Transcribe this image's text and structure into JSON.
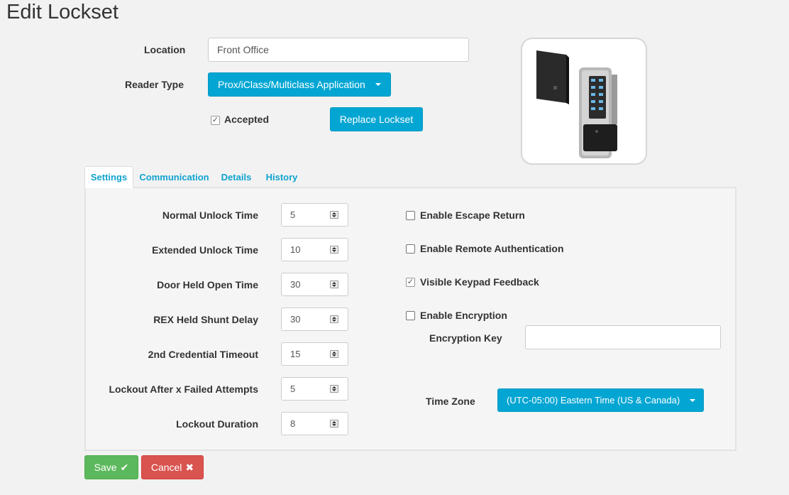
{
  "page": {
    "title": "Edit Lockset"
  },
  "form": {
    "location_label": "Location",
    "location_value": "Front Office",
    "reader_type_label": "Reader Type",
    "reader_type_value": "Prox/iClass/Multiclass Application",
    "accepted_label": "Accepted",
    "accepted_checked": true,
    "replace_button": "Replace Lockset"
  },
  "tabs": [
    {
      "label": "Settings",
      "active": true
    },
    {
      "label": "Communication",
      "active": false
    },
    {
      "label": "Details",
      "active": false
    },
    {
      "label": "History",
      "active": false
    }
  ],
  "settings": {
    "fields": [
      {
        "label": "Normal Unlock Time",
        "value": "5"
      },
      {
        "label": "Extended Unlock Time",
        "value": "10"
      },
      {
        "label": "Door Held Open Time",
        "value": "30"
      },
      {
        "label": "REX Held Shunt Delay",
        "value": "30"
      },
      {
        "label": "2nd Credential Timeout",
        "value": "15"
      },
      {
        "label": "Lockout After x Failed Attempts",
        "value": "5"
      },
      {
        "label": "Lockout Duration",
        "value": "8"
      }
    ],
    "options": [
      {
        "label": "Enable Escape Return",
        "checked": false
      },
      {
        "label": "Enable Remote Authentication",
        "checked": false
      },
      {
        "label": "Visible Keypad Feedback",
        "checked": true
      },
      {
        "label": "Enable Encryption",
        "checked": false
      }
    ],
    "encryption_key_label": "Encryption Key",
    "encryption_key_value": "",
    "time_zone_label": "Time Zone",
    "time_zone_value": "(UTC-05:00) Eastern Time (US & Canada)"
  },
  "actions": {
    "save": "Save",
    "cancel": "Cancel"
  },
  "icons": {
    "check": "✔",
    "cross": "✖",
    "checkmark": "✓"
  },
  "colors": {
    "accent": "#03a6d3",
    "save": "#5cb85c",
    "cancel": "#d9534f",
    "tab_text": "#0fa3cf"
  }
}
